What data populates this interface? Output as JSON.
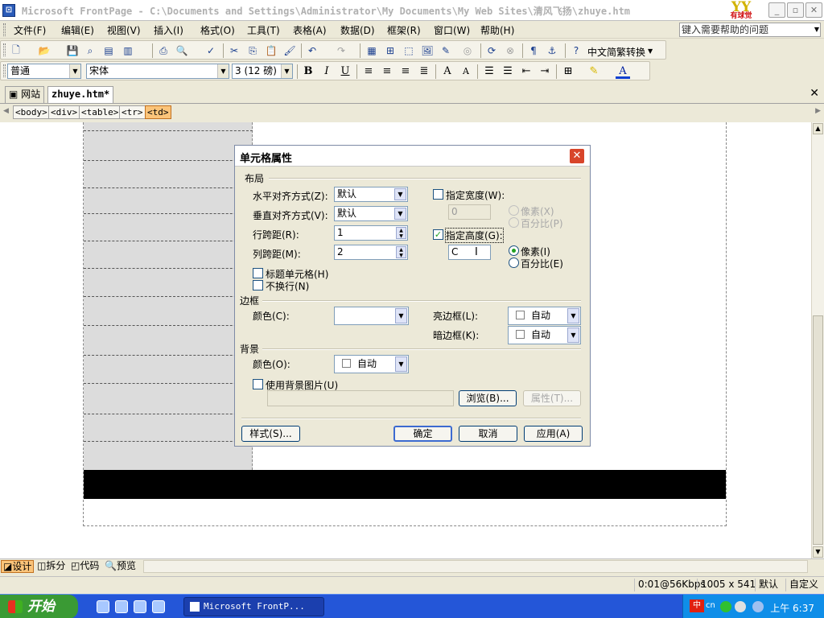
{
  "window": {
    "title": "Microsoft FrontPage - C:\\Documents and Settings\\Administrator\\My Documents\\My Web Sites\\清风飞扬\\zhuye.htm",
    "brand": "YY",
    "brand_sub": "有球觉",
    "minimize": "_",
    "maximize": "▫",
    "close": "✕"
  },
  "menu": {
    "items": [
      "文件(F)",
      "编辑(E)",
      "视图(V)",
      "插入(I)",
      "格式(O)",
      "工具(T)",
      "表格(A)",
      "数据(D)",
      "框架(R)",
      "窗口(W)",
      "帮助(H)"
    ],
    "help_placeholder": "键入需要帮助的问题"
  },
  "toolbar": {
    "convert_label": "中文简繁转换",
    "style_value": "普通",
    "font_value": "宋体",
    "size_value": "3 (12 磅)"
  },
  "tabs": {
    "site": "网站",
    "file": "zhuye.htm*",
    "close": "✕"
  },
  "tags": [
    "<body>",
    "<div>",
    "<table>",
    "<tr>",
    "<td>"
  ],
  "dialog": {
    "title": "单元格属性",
    "close": "✕",
    "layout_group": "布局",
    "h_align_label": "水平对齐方式(Z):",
    "h_align_value": "默认",
    "v_align_label": "垂直对齐方式(V):",
    "v_align_value": "默认",
    "rowspan_label": "行跨距(R):",
    "rowspan_value": "1",
    "colspan_label": "列跨距(M):",
    "colspan_value": "2",
    "header_cell_label": "标题单元格(H)",
    "nowrap_label": "不换行(N)",
    "width_label": "指定宽度(W):",
    "width_value": "0",
    "width_px_label": "像素(X)",
    "width_pct_label": "百分比(P)",
    "height_label": "指定高度(G):",
    "height_value": "C",
    "height_px_label": "像素(I)",
    "height_pct_label": "百分比(E)",
    "border_group": "边框",
    "border_color_label": "颜色(C):",
    "light_border_label": "亮边框(L):",
    "light_border_value": "自动",
    "dark_border_label": "暗边框(K):",
    "dark_border_value": "自动",
    "bg_group": "背景",
    "bg_color_label": "颜色(O):",
    "bg_color_value": "自动",
    "bg_image_label": "使用背景图片(U)",
    "browse_button": "浏览(B)...",
    "properties_button": "属性(T)...",
    "style_button": "样式(S)...",
    "ok_button": "确定",
    "cancel_button": "取消",
    "apply_button": "应用(A)"
  },
  "views": {
    "design": "设计",
    "split": "拆分",
    "code": "代码",
    "preview": "预览"
  },
  "status": {
    "speed": "0:01@56Kbps",
    "size": "1005 x 541",
    "mode": "默认",
    "custom": "自定义"
  },
  "taskbar": {
    "start": "开始",
    "task": "Microsoft FrontP...",
    "ime": "cn",
    "clock": "上午 6:37"
  },
  "colors": {
    "accent": "#2456d8",
    "selection": "#fbc47a",
    "dialog_close": "#d8452a",
    "start": "#3a9a34"
  }
}
